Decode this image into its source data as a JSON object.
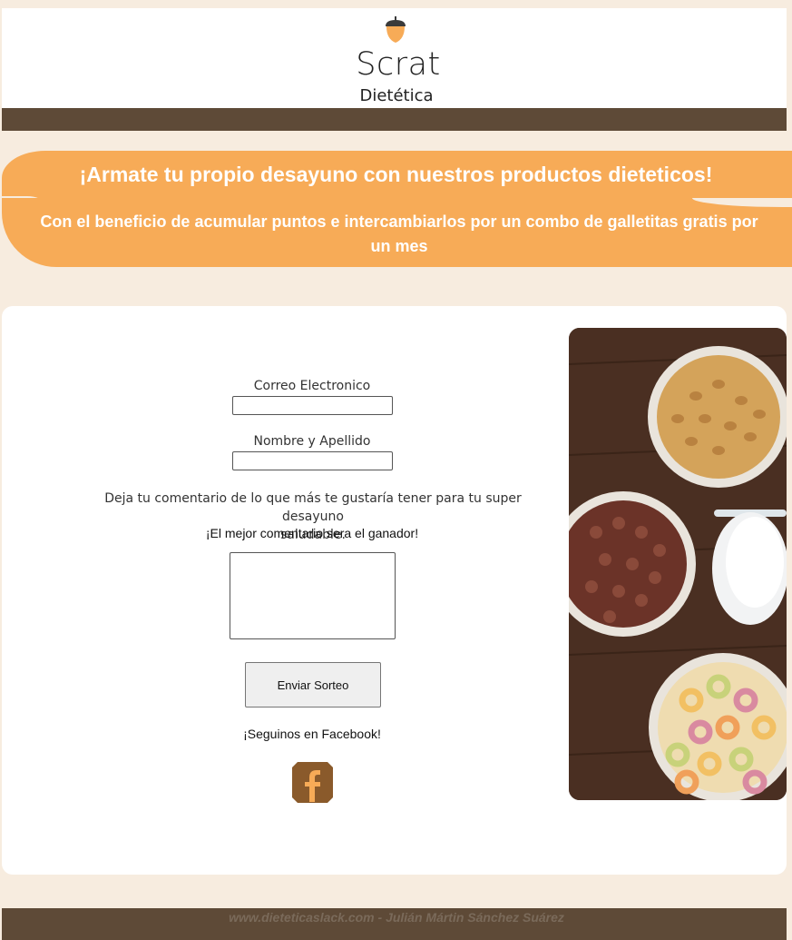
{
  "header": {
    "brand": "Scrat",
    "brand_sub": "Dietética"
  },
  "banner": {
    "title": "¡Armate tu propio desayuno con nuestros productos dieteticos!",
    "subtitle_line1": "Con el beneficio de acumular puntos e intercambiarlos por un combo de galletitas gratis por",
    "subtitle_line2": "un mes"
  },
  "form": {
    "email_label": "Correo Electronico",
    "email_value": "",
    "name_label": "Nombre y Apellido",
    "name_value": "",
    "comment_prompt_line1": "Deja tu comentario de lo que más te gustaría tener para tu super desayuno",
    "comment_prompt_line2": "saludable.",
    "comment_highlight": "¡El mejor comentario sera el ganador!",
    "comment_value": "",
    "submit_label": "Enviar Sorteo",
    "facebook_text": "¡Seguinos en Facebook!"
  },
  "icons": {
    "logo": "acorn-icon",
    "social": "facebook-icon"
  },
  "colors": {
    "accent": "#f7ab57",
    "dark": "#5e4a37",
    "background": "#f7ecdf"
  },
  "footer": {
    "text": "www.dieteticaslack.com - Julián Mártin Sánchez Suárez"
  }
}
